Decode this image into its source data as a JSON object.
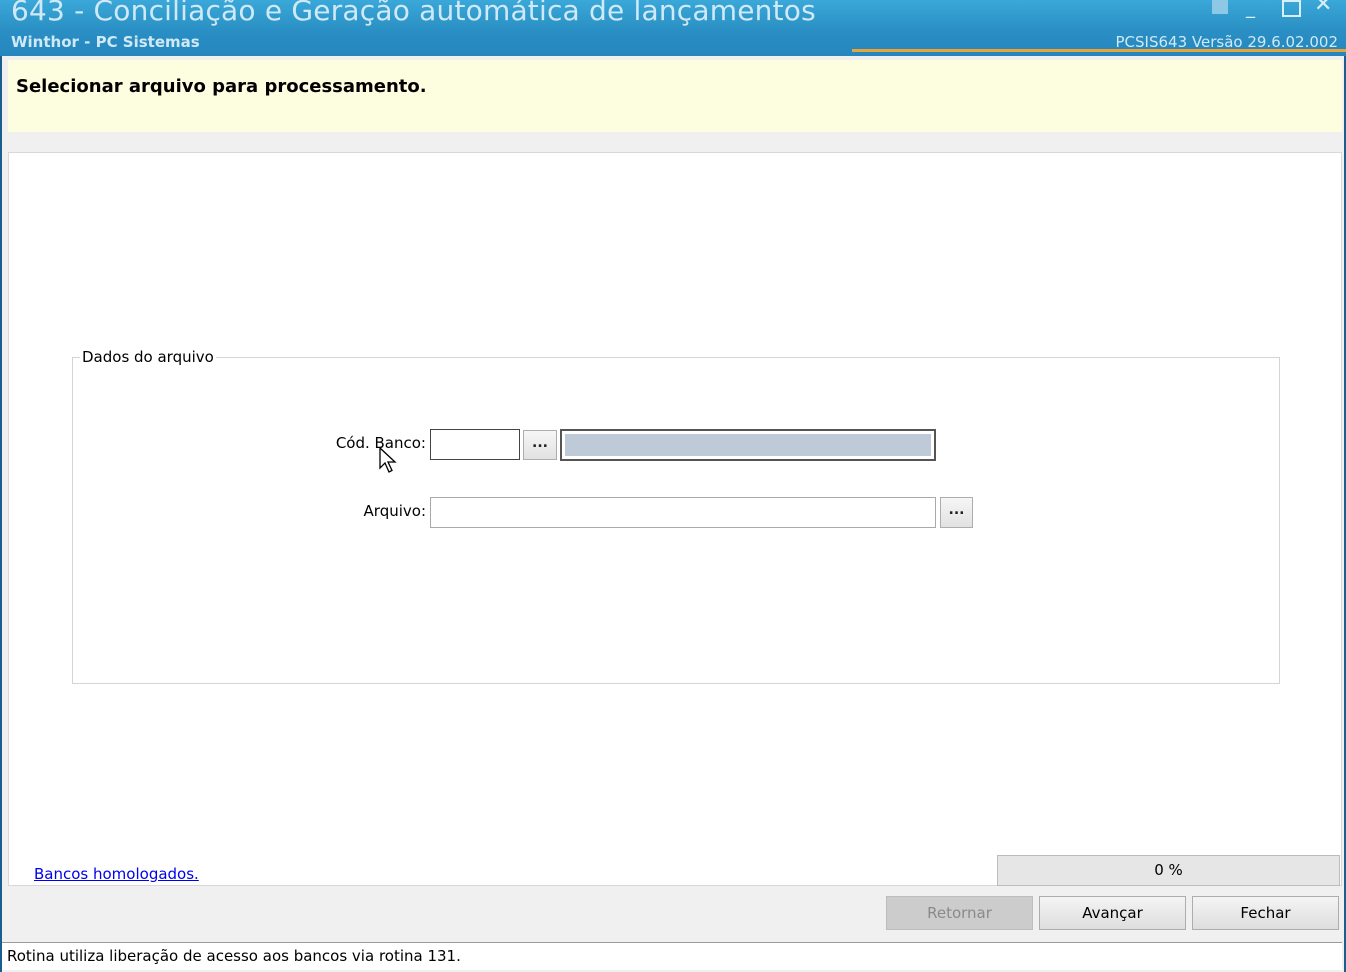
{
  "window": {
    "title": "643 - Conciliação e Geração automática de lançamentos",
    "subtitle": "Winthor - PC Sistemas",
    "version": "PCSIS643  Versão  29.6.02.002",
    "controls": [
      "pin-icon",
      "minimize-icon",
      "maximize-icon",
      "close-icon"
    ]
  },
  "header": {
    "title": "Selecionar arquivo para processamento."
  },
  "group": {
    "label": "Dados do arquivo",
    "cod_banco_label": "Cód. Banco:",
    "cod_banco_value": "",
    "cod_banco_button": "...",
    "banco_desc_value": "",
    "arquivo_label": "Arquivo:",
    "arquivo_value": "",
    "arquivo_button": "..."
  },
  "footer": {
    "link_label": "Bancos homologados.",
    "progress_text": "0 %",
    "progress_value": 0,
    "buttons": {
      "retornar": "Retornar",
      "avancar": "Avançar",
      "fechar": "Fechar"
    }
  },
  "statusbar": {
    "text": "Rotina utiliza liberação de acesso aos bancos via rotina 131."
  },
  "colors": {
    "titlebar": "#2a8fc4",
    "header_bg": "#fdfde0",
    "accent": "#e8a33a",
    "link": "#0000ee"
  }
}
